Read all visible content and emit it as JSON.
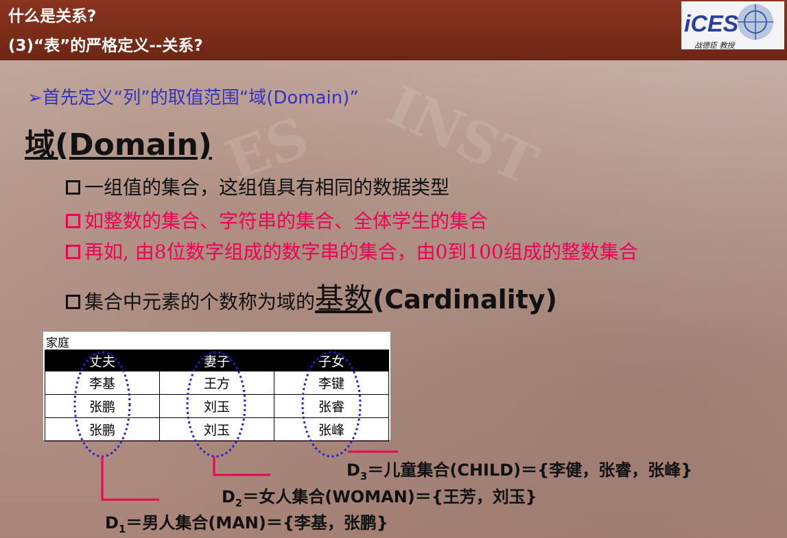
{
  "header": {
    "title_line1": "什么是关系?",
    "title_line2": "(3)“表”的严格定义--关系?",
    "logo_text": "iCES",
    "logo_caption": "战德臣 教授"
  },
  "intro": {
    "prefix_glyph": "➢",
    "text": "首先定义“列”的取值范围“域(Domain)”"
  },
  "domain_title": "域(Domain)",
  "bullets": [
    {
      "text": "一组值的集合，这组值具有相同的数据类型",
      "color": "#111111"
    },
    {
      "text": "如整数的集合、字符串的集合、全体学生的集合",
      "color": "#ee0055"
    },
    {
      "text": "再如, 由8位数字组成的数字串的集合，由0到100组成的整数集合",
      "color": "#ee0055"
    }
  ],
  "cardinality": {
    "prefix": "集合中元素的个数称为域的",
    "term": "基数",
    "english": "(Cardinality)"
  },
  "table": {
    "caption": "家庭",
    "headers": [
      "丈夫",
      "妻子",
      "子女"
    ],
    "rows": [
      [
        "李基",
        "王方",
        "李键"
      ],
      [
        "张鹏",
        "刘玉",
        "张睿"
      ],
      [
        "张鹏",
        "刘玉",
        "张峰"
      ]
    ]
  },
  "sets": {
    "d3": {
      "name": "D",
      "sub": "3",
      "text": "＝儿童集合(CHILD)＝{李健，张睿，张峰}"
    },
    "d2": {
      "name": "D",
      "sub": "2",
      "text": "＝女人集合(WOMAN)＝{王芳，刘玉}"
    },
    "d1": {
      "name": "D",
      "sub": "1",
      "text": "＝男人集合(MAN)＝{李基，张鹏}"
    }
  },
  "colors": {
    "header_bg": "#7a2c18",
    "accent_pink": "#ee0055",
    "accent_blue": "#3333bb",
    "ellipse_blue": "#2222cc"
  }
}
